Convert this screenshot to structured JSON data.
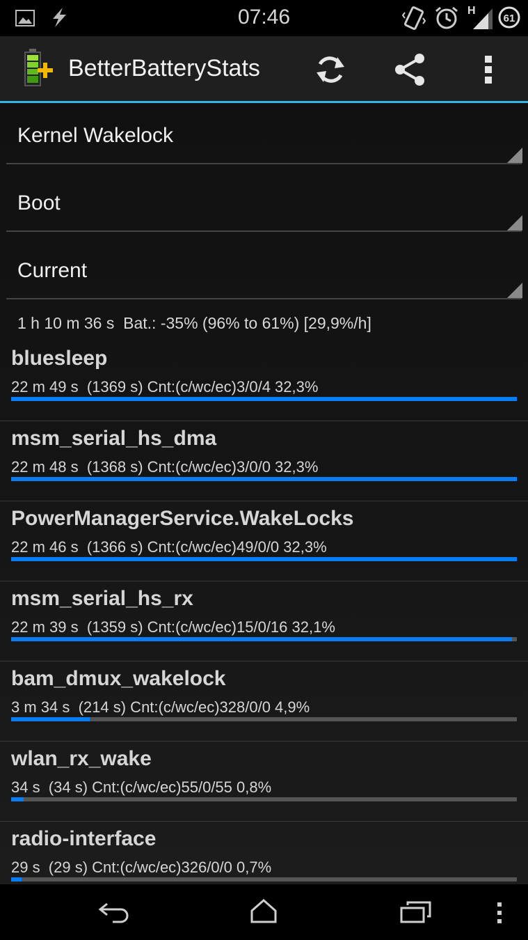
{
  "status_bar": {
    "time": "07:46",
    "battery_level": "61",
    "network_type": "H",
    "icons": [
      "image-notification-icon",
      "flash-notification-icon",
      "vibrate-icon",
      "alarm-icon",
      "signal-icon",
      "battery-icon"
    ]
  },
  "action_bar": {
    "title": "BetterBatteryStats",
    "icons": [
      "app-battery-icon",
      "refresh-icon",
      "share-icon",
      "overflow-menu-icon"
    ]
  },
  "filters": {
    "stat_type": "Kernel Wakelock",
    "from_ref": "Boot",
    "to_ref": "Current"
  },
  "summary": "1 h 10 m 36 s  Bat.: -35% (96% to 61%) [29,9%/h]",
  "colors": {
    "accent": "#33b5e5",
    "bar_fill": "#0a7df2",
    "bar_track": "#555555"
  },
  "wakelocks": [
    {
      "name": "bluesleep",
      "detail": "22 m 49 s  (1369 s) Cnt:(c/wc/ec)3/0/4 32,3%",
      "bar_fraction": 1.0
    },
    {
      "name": "msm_serial_hs_dma",
      "detail": "22 m 48 s  (1368 s) Cnt:(c/wc/ec)3/0/0 32,3%",
      "bar_fraction": 1.0
    },
    {
      "name": "PowerManagerService.WakeLocks",
      "detail": "22 m 46 s  (1366 s) Cnt:(c/wc/ec)49/0/0 32,3%",
      "bar_fraction": 1.0
    },
    {
      "name": "msm_serial_hs_rx",
      "detail": "22 m 39 s  (1359 s) Cnt:(c/wc/ec)15/0/16 32,1%",
      "bar_fraction": 0.99
    },
    {
      "name": "bam_dmux_wakelock",
      "detail": "3 m 34 s  (214 s) Cnt:(c/wc/ec)328/0/0 4,9%",
      "bar_fraction": 0.156
    },
    {
      "name": "wlan_rx_wake",
      "detail": "34 s  (34 s) Cnt:(c/wc/ec)55/0/55 0,8%",
      "bar_fraction": 0.025
    },
    {
      "name": "radio-interface",
      "detail": "29 s  (29 s) Cnt:(c/wc/ec)326/0/0 0,7%",
      "bar_fraction": 0.021
    }
  ],
  "nav_bar": {
    "icons": [
      "back-icon",
      "home-icon",
      "recents-icon",
      "menu-icon"
    ]
  }
}
